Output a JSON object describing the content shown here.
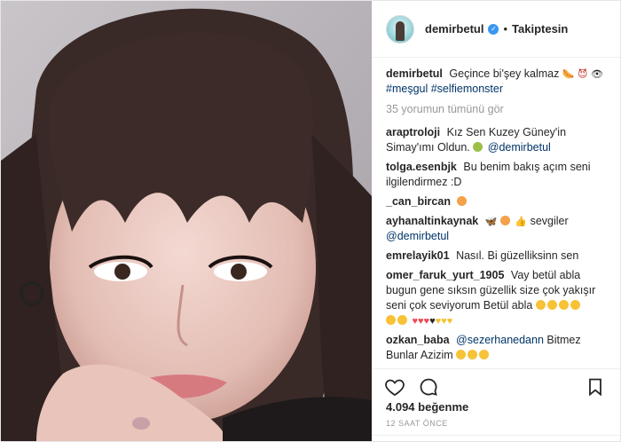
{
  "account": {
    "username": "demirbetul",
    "verified_icon": "verified-badge-icon",
    "separator": "•",
    "follow_label": "Takiptesin"
  },
  "caption": {
    "username": "demirbetul",
    "text": "Geçince bi'şey kalmaz",
    "emojis": [
      "hot-dog-icon",
      "devil-face-icon",
      "eye-icon"
    ],
    "hashtags": "#meşgul #selfiemonster"
  },
  "view_all": "35 yorumun tümünü gör",
  "comments": [
    {
      "user": "araptroloji",
      "text": "Kız Sen Kuzey Güney'in Simay'ımı Oldun.",
      "mention": "@demirbetul"
    },
    {
      "user": "tolga.esenbjk",
      "text": "Bu benim bakış açım seni ilgilendirmez :D"
    },
    {
      "user": "_can_bircan",
      "text": ""
    },
    {
      "user": "ayhanaltinkaynak",
      "text": "sevgiler",
      "mention": "@demirbetul"
    },
    {
      "user": "emrelayik01",
      "text": "Nasıl. Bi güzelliksinn sen"
    },
    {
      "user": "omer_faruk_yurt_1905",
      "text": "Vay betül abla bugun gene sıksın güzellik size çok yakışır seni çok seviyorum Betül abla"
    },
    {
      "user": "ozkan_baba",
      "mention": "@sezerhanedann",
      "text": "Bitmez Bunlar Azizim"
    }
  ],
  "actions": {
    "like_icon": "heart-icon",
    "comment_icon": "comment-icon",
    "save_icon": "bookmark-icon"
  },
  "likes_count": "4.094",
  "likes_label": "beğenme",
  "timestamp": "12 SAAT ÖNCE",
  "colors": {
    "link": "#003569",
    "muted": "#999999",
    "verified": "#3897f0",
    "heart": "#ed4956"
  }
}
